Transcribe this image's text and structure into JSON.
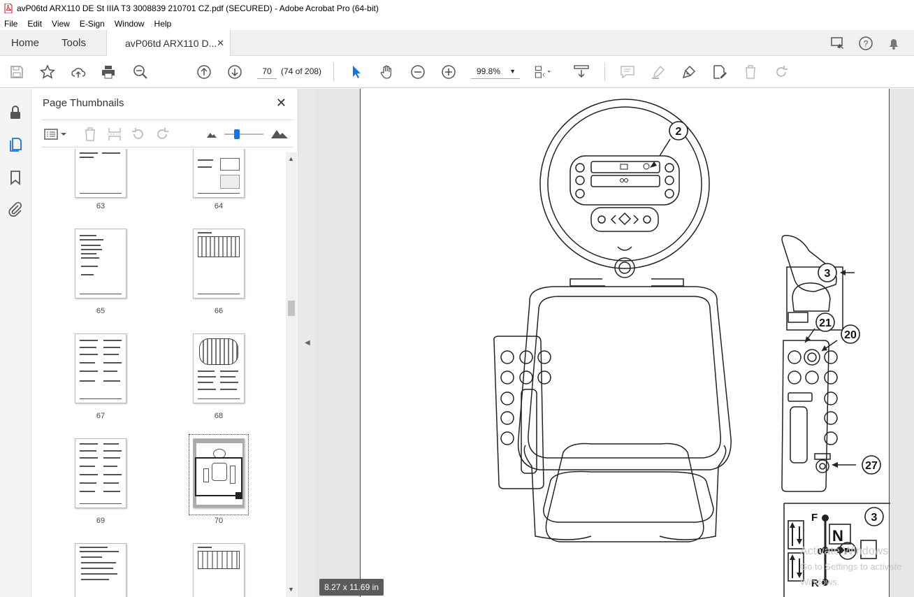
{
  "window": {
    "title": "avP06td ARX110 DE St IIIA T3 3008839 210701 CZ.pdf (SECURED) - Adobe Acrobat Pro (64-bit)"
  },
  "menu": {
    "items": [
      "File",
      "Edit",
      "View",
      "E-Sign",
      "Window",
      "Help"
    ]
  },
  "tabs": {
    "home": "Home",
    "tools": "Tools",
    "doc": "avP06td ARX110 D..."
  },
  "toolbar": {
    "page_number": "70",
    "page_count": "(74 of 208)",
    "zoom": "99.8%"
  },
  "panel": {
    "title": "Page Thumbnails",
    "thumbnails": [
      {
        "label": "63"
      },
      {
        "label": "64"
      },
      {
        "label": "65"
      },
      {
        "label": "66"
      },
      {
        "label": "67"
      },
      {
        "label": "68"
      },
      {
        "label": "69"
      },
      {
        "label": "70"
      }
    ]
  },
  "document": {
    "callouts": [
      "2",
      "3",
      "21",
      "20",
      "27"
    ],
    "inset": {
      "number": "3",
      "f": "F",
      "zero": "0",
      "r": "R",
      "n": "N",
      "p": "P"
    }
  },
  "status": {
    "page_size": "8.27 x 11.69 in"
  },
  "watermark": {
    "line1": "Activate Windows",
    "line2": "Go to Settings to activate Windows."
  },
  "colors": {
    "accent": "#1473e6",
    "toolbar_bg": "#ffffff",
    "tab_bg": "#f0f0f0"
  }
}
